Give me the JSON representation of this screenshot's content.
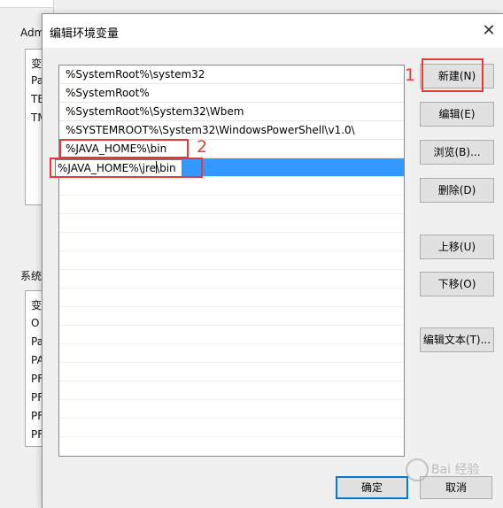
{
  "background_window": {
    "title_fragment": "Adm",
    "section1_rows": [
      "变",
      "Pa",
      "TE",
      "TM"
    ],
    "section2_label": "系统",
    "section2_rows": [
      "变",
      "O",
      "Pa",
      "PA",
      "PF",
      "PF",
      "PF",
      "PF"
    ]
  },
  "dialog": {
    "title": "编辑环境变量",
    "close_glyph": "✕",
    "paths": [
      "%SystemRoot%\\system32",
      "%SystemRoot%",
      "%SystemRoot%\\System32\\Wbem",
      "%SYSTEMROOT%\\System32\\WindowsPowerShell\\v1.0\\",
      "%JAVA_HOME%\\bin"
    ],
    "editing_value_before": "%JAVA_HOME%\\jre",
    "editing_value_after": "\\bin",
    "buttons": {
      "new": "新建(N)",
      "edit": "编辑(E)",
      "browse": "浏览(B)...",
      "delete": "删除(D)",
      "move_up": "上移(U)",
      "move_down": "下移(O)",
      "edit_text": "编辑文本(T)...",
      "ok": "确定",
      "cancel": "取消"
    },
    "annotations": {
      "one": "1",
      "two": "2"
    },
    "watermark": "Bai  经验"
  }
}
